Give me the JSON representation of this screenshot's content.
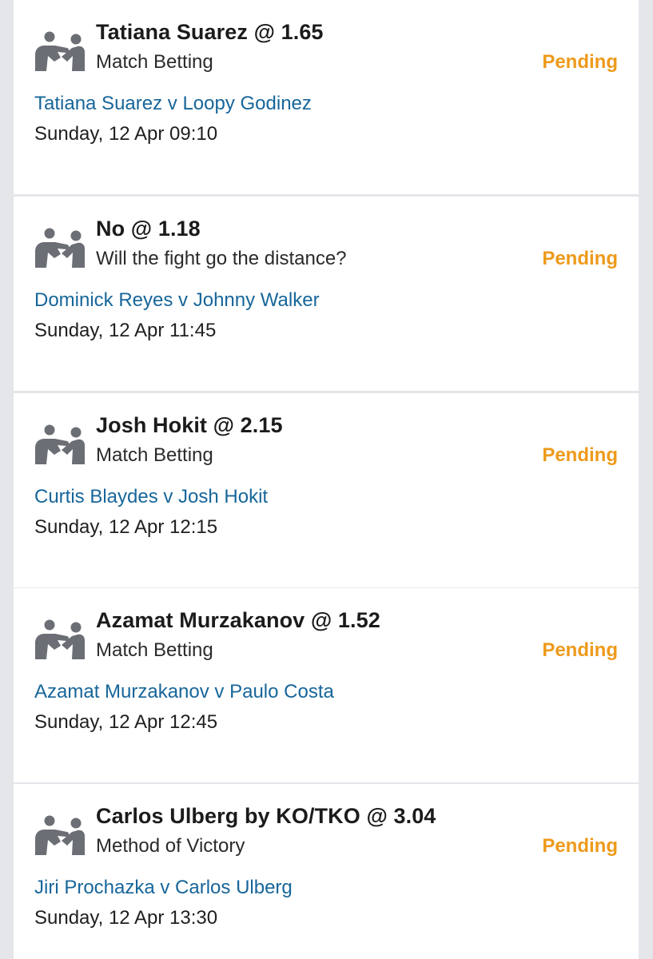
{
  "bets": [
    {
      "selection": "Tatiana Suarez @ 1.65",
      "market": "Match Betting",
      "status": "Pending",
      "event": "Tatiana Suarez v Loopy Godinez",
      "datetime": "Sunday, 12 Apr 09:10",
      "icon": "fighters-icon"
    },
    {
      "selection": "No @ 1.18",
      "market": "Will the fight go the distance?",
      "status": "Pending",
      "event": "Dominick Reyes v Johnny Walker",
      "datetime": "Sunday, 12 Apr 11:45",
      "icon": "fighters-icon"
    },
    {
      "selection": "Josh Hokit @ 2.15",
      "market": "Match Betting",
      "status": "Pending",
      "event": "Curtis Blaydes v Josh Hokit",
      "datetime": "Sunday, 12 Apr 12:15",
      "icon": "fighters-icon"
    },
    {
      "selection": "Azamat Murzakanov @ 1.52",
      "market": "Match Betting",
      "status": "Pending",
      "event": "Azamat Murzakanov v Paulo Costa",
      "datetime": "Sunday, 12 Apr 12:45",
      "icon": "fighters-icon"
    },
    {
      "selection": "Carlos Ulberg by KO/TKO @ 3.04",
      "market": "Method of Victory",
      "status": "Pending",
      "event": "Jiri Prochazka v Carlos Ulberg",
      "datetime": "Sunday, 12 Apr 13:30",
      "icon": "fighters-icon"
    }
  ],
  "colors": {
    "pending": "#ee9a1b",
    "event_link": "#17669a",
    "icon": "#6b6e74",
    "background": "#e4e6ea",
    "card": "#ffffff"
  }
}
